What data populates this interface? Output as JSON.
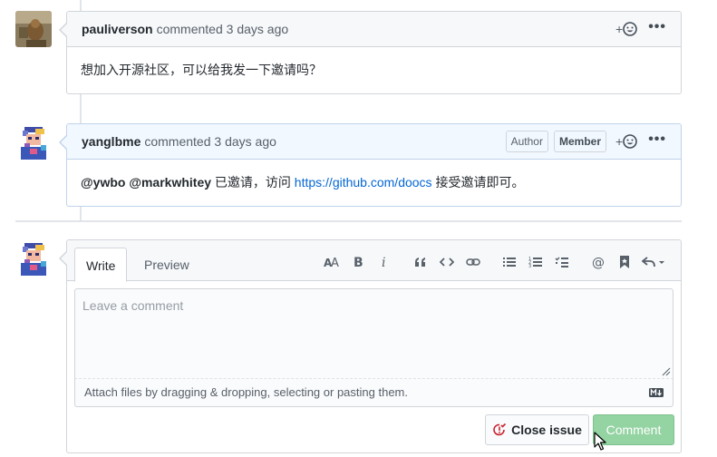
{
  "comments": [
    {
      "user": "pauliverson",
      "action": "commented",
      "time": "3 days ago",
      "body": "想加入开源社区，可以给我发一下邀请吗？",
      "reaction_label": "+",
      "menu_label": "•••"
    },
    {
      "user": "yanglbme",
      "action": "commented",
      "time": "3 days ago",
      "badges": [
        "Author",
        "Member"
      ],
      "body_parts": {
        "mention1": "@ywbo",
        "mention2": "@markwhitey",
        "text1": " 已邀请，访问 ",
        "link": "https://github.com/doocs",
        "text2": " 接受邀请即可。"
      },
      "reaction_label": "+",
      "menu_label": "•••"
    }
  ],
  "editor": {
    "tabs": [
      "Write",
      "Preview"
    ],
    "placeholder": "Leave a comment",
    "attach_text": "Attach files by dragging & dropping, selecting or pasting them.",
    "toolbar_icons": [
      "text-size-icon",
      "bold-icon",
      "italic-icon",
      "quote-icon",
      "code-icon",
      "link-icon",
      "unordered-list-icon",
      "ordered-list-icon",
      "task-list-icon",
      "mention-icon",
      "reference-icon",
      "reply-icon"
    ],
    "close_label": "Close issue",
    "comment_label": "Comment"
  },
  "colors": {
    "link": "#0366d6",
    "author_header_bg": "#f1f8ff",
    "comment_button_disabled": "#94d3a2"
  }
}
